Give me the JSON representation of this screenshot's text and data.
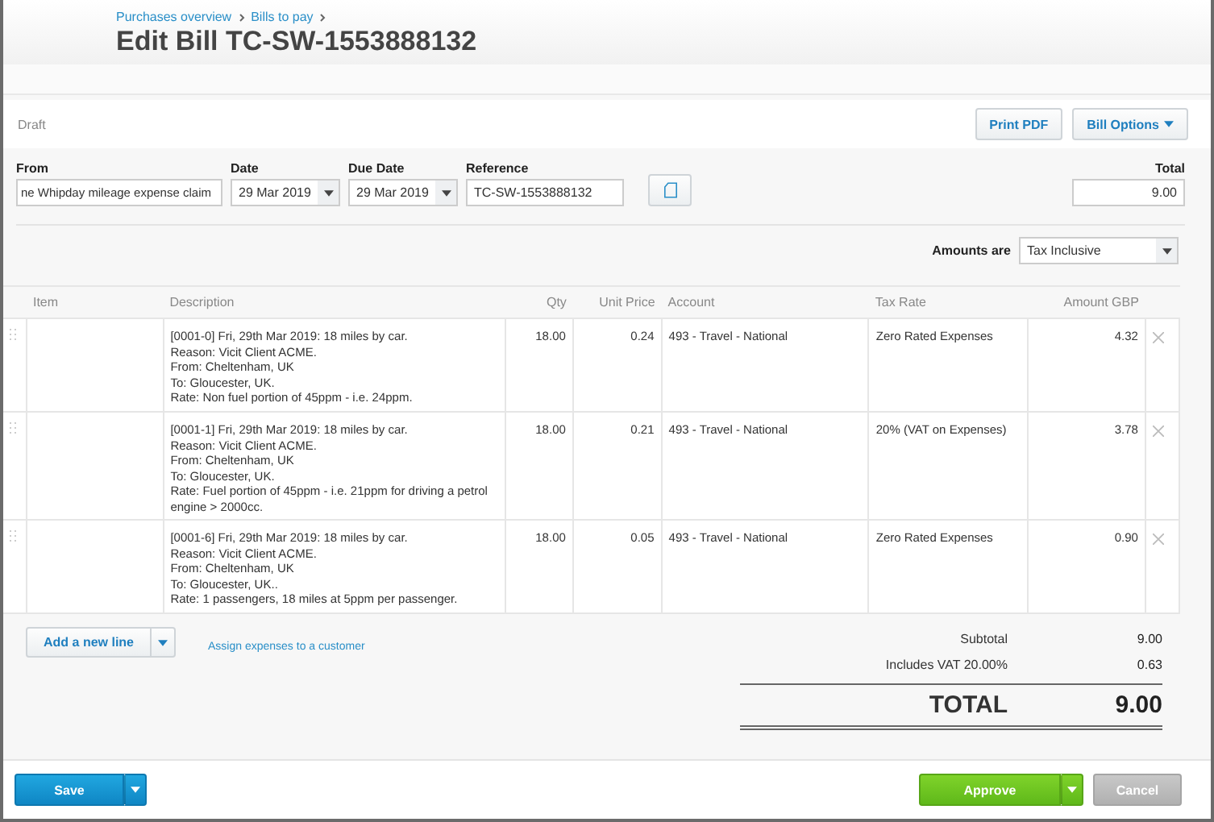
{
  "breadcrumbs": [
    "Purchases overview",
    "Bills to pay"
  ],
  "title": "Edit Bill TC-SW-1553888132",
  "status": "Draft",
  "actions": [
    "Print PDF",
    "Bill Options"
  ],
  "fields": [
    {
      "label": "From",
      "value": "ne Whipday mileage expense claim",
      "kind": "text"
    },
    {
      "label": "Date",
      "value": "29 Mar 2019",
      "kind": "select"
    },
    {
      "label": "Due Date",
      "value": "29 Mar 2019",
      "kind": "select"
    },
    {
      "label": "Reference",
      "value": "TC-SW-1553888132",
      "kind": "text"
    }
  ],
  "total_field": {
    "label": "Total",
    "value": "9.00"
  },
  "amounts_are": {
    "label": "Amounts are",
    "value": "Tax Inclusive"
  },
  "table": {
    "columns": [
      "Item",
      "Description",
      "Qty",
      "Unit Price",
      "Account",
      "Tax Rate",
      "Amount GBP"
    ],
    "rows": [
      {
        "item": "",
        "description": "[0001-0] Fri, 29th Mar 2019: 18 miles by car.\nReason: Vicit Client ACME.\nFrom: Cheltenham, UK\nTo: Gloucester, UK.\nRate: Non fuel portion of 45ppm - i.e. 24ppm.",
        "qty": "18.00",
        "unit_price": "0.24",
        "account": "493 - Travel - National",
        "tax_rate": "Zero Rated Expenses",
        "amount": "4.32"
      },
      {
        "item": "",
        "description": "[0001-1] Fri, 29th Mar 2019: 18 miles by car.\nReason: Vicit Client ACME.\nFrom: Cheltenham, UK\nTo: Gloucester, UK.\nRate: Fuel portion of 45ppm - i.e. 21ppm for driving a petrol engine > 2000cc.",
        "qty": "18.00",
        "unit_price": "0.21",
        "account": "493 - Travel - National",
        "tax_rate": "20% (VAT on Expenses)",
        "amount": "3.78"
      },
      {
        "item": "",
        "description": "[0001-6] Fri, 29th Mar 2019: 18 miles by car.\nReason: Vicit Client ACME.\nFrom: Cheltenham, UK\nTo: Gloucester, UK..\nRate: 1 passengers, 18 miles at 5ppm per passenger.",
        "qty": "18.00",
        "unit_price": "0.05",
        "account": "493 - Travel - National",
        "tax_rate": "Zero Rated Expenses",
        "amount": "0.90"
      }
    ]
  },
  "add_line": "Add a new line",
  "assign_link": "Assign expenses to a customer",
  "totals": [
    {
      "label": "Subtotal",
      "value": "9.00"
    },
    {
      "label": "Includes VAT 20.00%",
      "value": "0.63"
    }
  ],
  "grand_total": {
    "label": "TOTAL",
    "value": "9.00"
  },
  "footer": {
    "save": "Save",
    "approve": "Approve",
    "cancel": "Cancel"
  }
}
